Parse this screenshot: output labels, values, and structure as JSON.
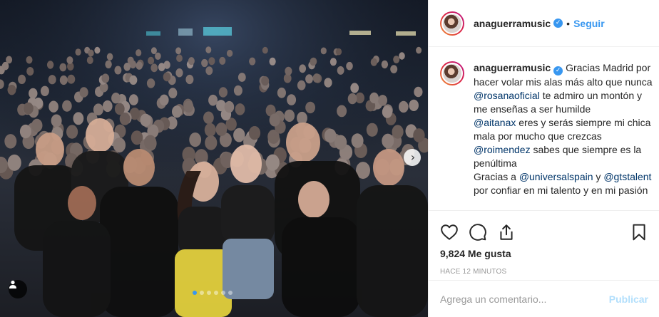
{
  "post": {
    "username": "anaguerramusic",
    "verified_glyph": "✓",
    "separator": "•",
    "follow_label": "Seguir",
    "caption": {
      "intro": "Gracias Madrid por hacer volar mis alas más alto que nunca",
      "m1": "@rosanaoficial",
      "t1": "te admiro un montón y me enseñas a ser humilde",
      "m2": "@aitanax",
      "t2": "eres y serás siempre mi chica mala por mucho que crezcas",
      "m3": "@roimendez",
      "t3": "sabes que siempre es la penúltima",
      "t4": "Gracias a",
      "m4": "@universalspain",
      "t5": "y",
      "m5": "@gtstalent",
      "t6": "por confiar en mi talento y en mi pasión"
    },
    "likes": "9,824 Me gusta",
    "timestamp": "HACE 12 MINUTOS",
    "comment_placeholder": "Agrega un comentario...",
    "publish_label": "Publicar"
  },
  "carousel": {
    "count": 6,
    "active_index": 0
  },
  "icons": {
    "like": "heart-icon",
    "comment": "comment-icon",
    "share": "share-icon",
    "save": "bookmark-icon",
    "next": "chevron-right-icon",
    "tag": "user-tag-icon"
  },
  "colors": {
    "accent": "#3897f0",
    "mention": "#003569",
    "publish_disabled": "#b2dffc",
    "muted": "#999999"
  }
}
